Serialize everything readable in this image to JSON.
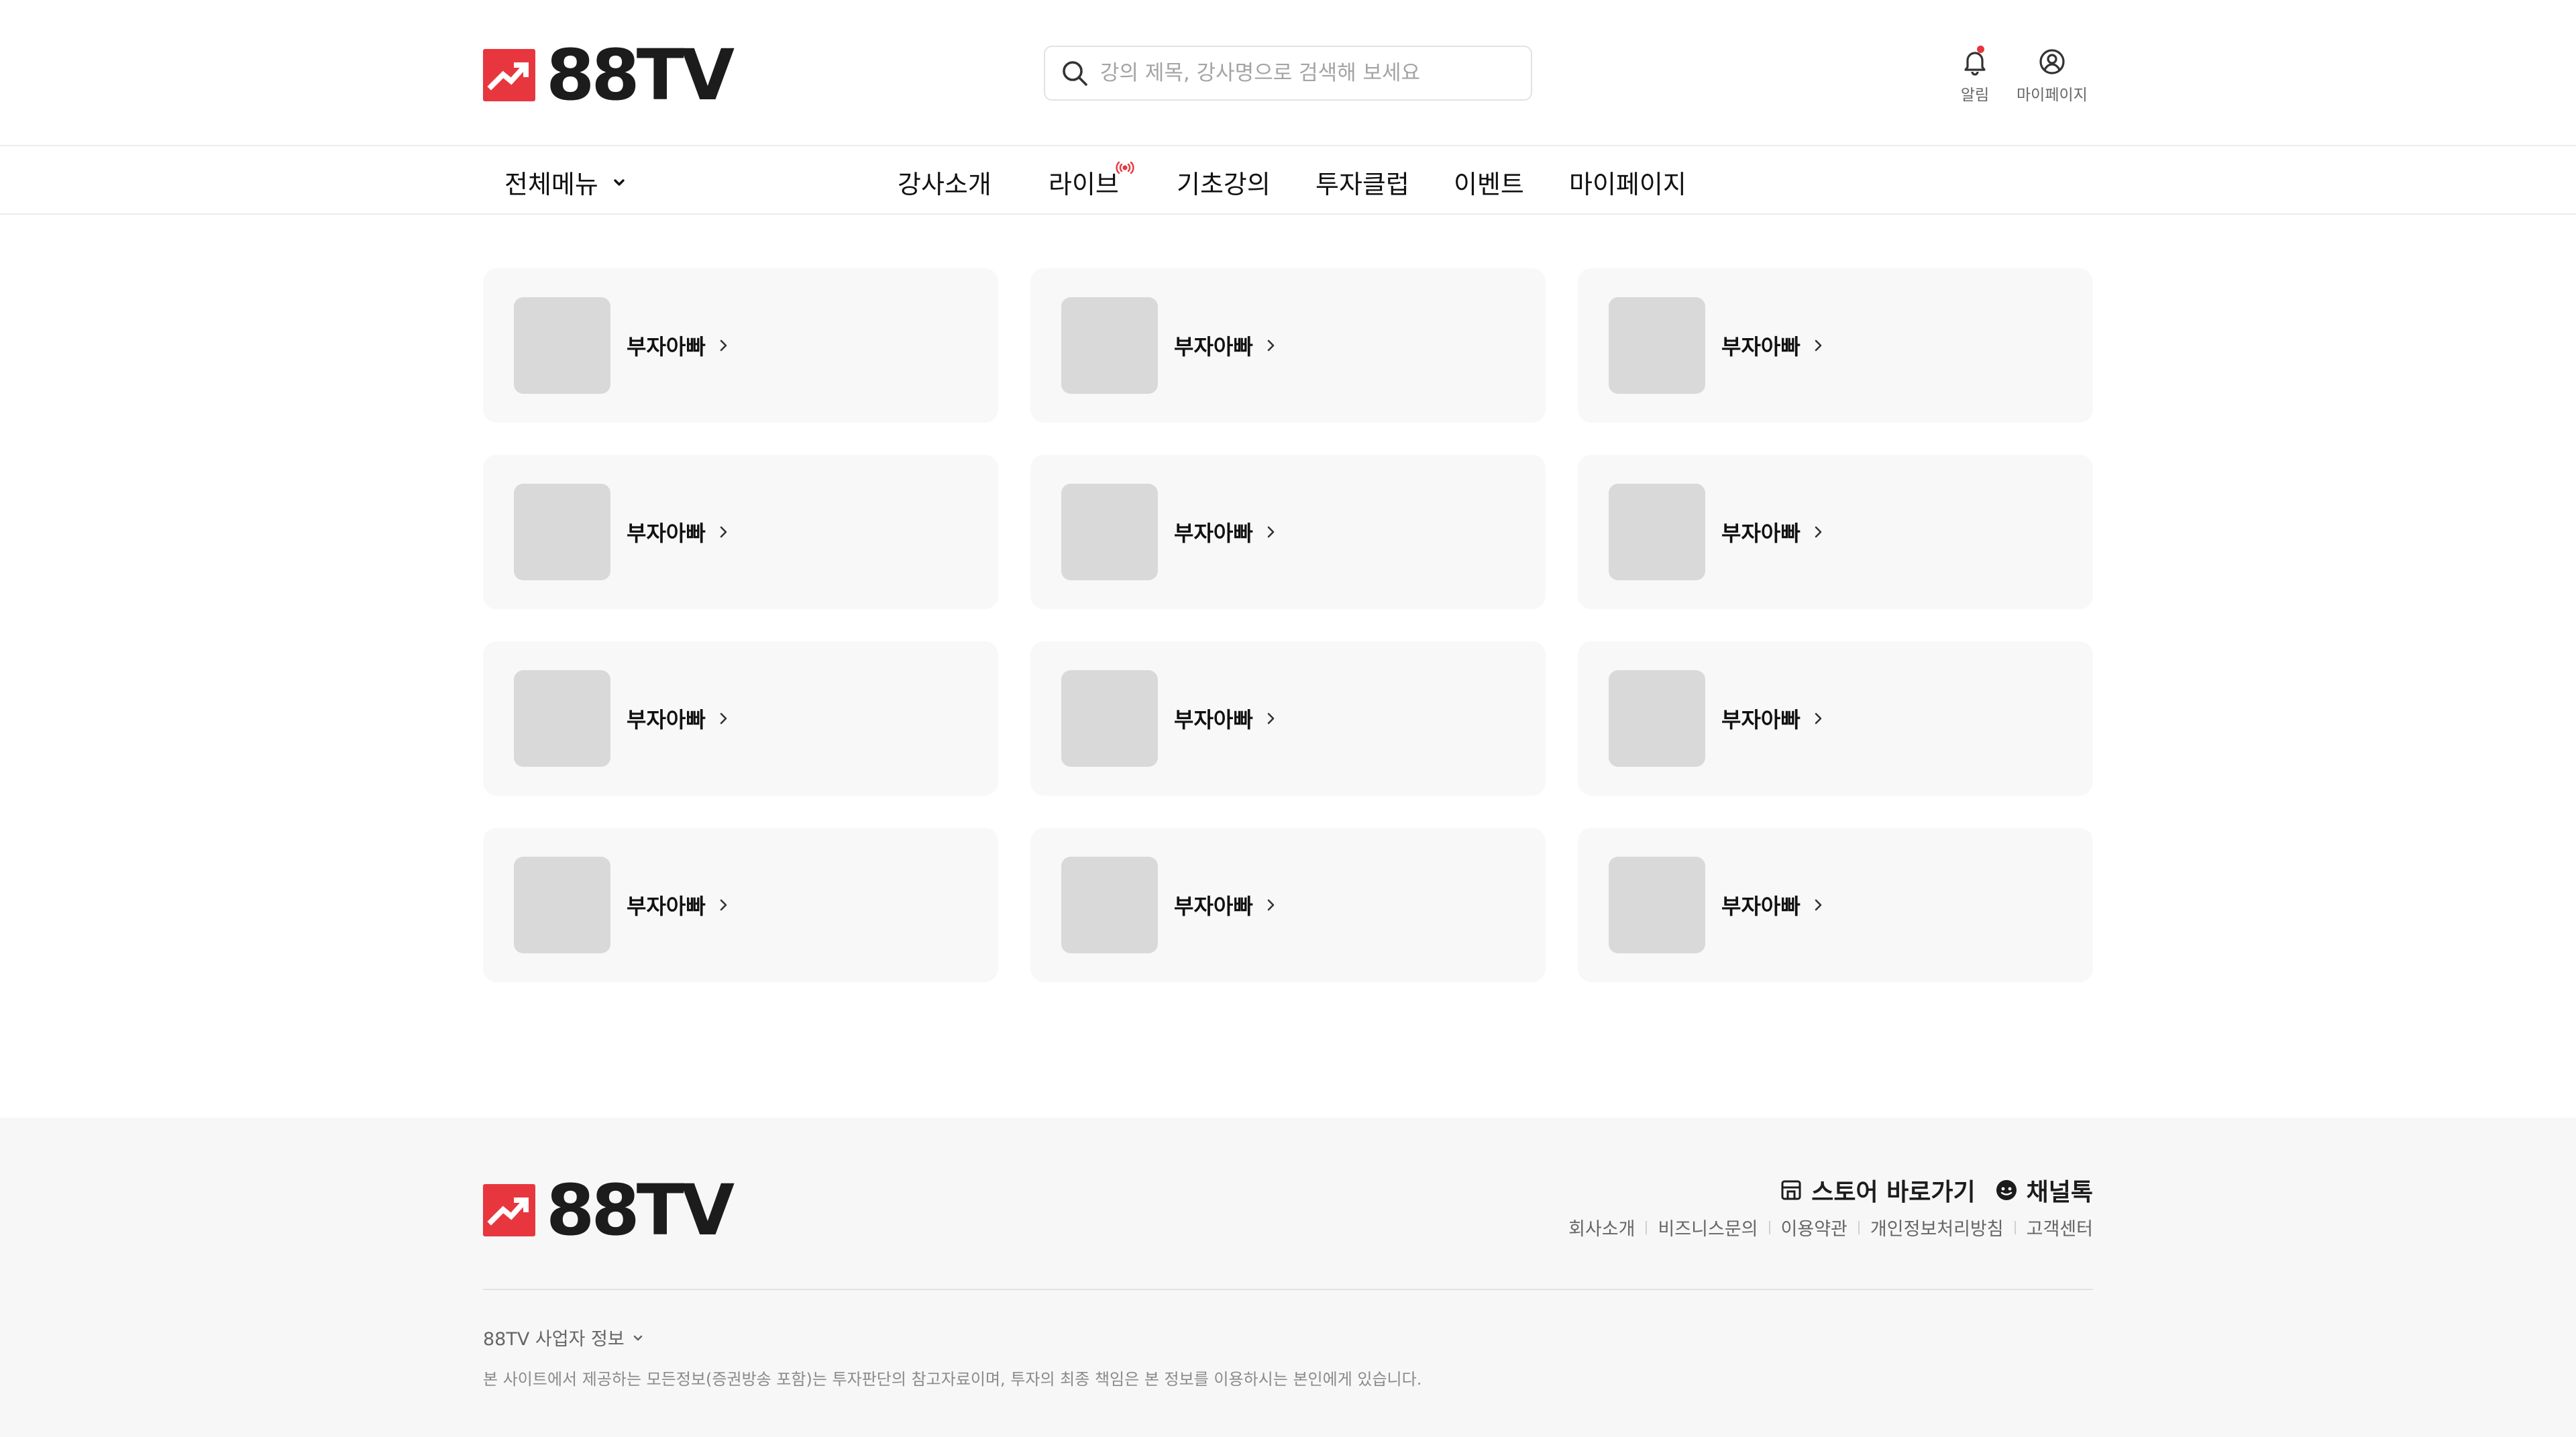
{
  "header": {
    "logo_text": "88TV",
    "search_placeholder": "강의 제목, 강사명으로 검색해 보세요",
    "alarm_label": "알림",
    "mypage_label": "마이페이지"
  },
  "nav": {
    "all_menu": "전체메뉴",
    "items": [
      "강사소개",
      "라이브",
      "기초강의",
      "투자클럽",
      "이벤트",
      "마이페이지"
    ]
  },
  "instructors": [
    {
      "name": "부자아빠"
    },
    {
      "name": "부자아빠"
    },
    {
      "name": "부자아빠"
    },
    {
      "name": "부자아빠"
    },
    {
      "name": "부자아빠"
    },
    {
      "name": "부자아빠"
    },
    {
      "name": "부자아빠"
    },
    {
      "name": "부자아빠"
    },
    {
      "name": "부자아빠"
    },
    {
      "name": "부자아빠"
    },
    {
      "name": "부자아빠"
    },
    {
      "name": "부자아빠"
    }
  ],
  "footer": {
    "logo_text": "88TV",
    "store_link": "스토어 바로가기",
    "channel_link": "채널톡",
    "links": [
      "회사소개",
      "비즈니스문의",
      "이용약관",
      "개인정보처리방침",
      "고객센터"
    ],
    "business_info": "88TV 사업자 정보",
    "disclaimer": "본 사이트에서 제공하는 모든정보(증권방송 포함)는 투자판단의 참고자료이며, 투자의 최종 책임은 본 정보를 이용하시는 본인에게 있습니다."
  },
  "colors": {
    "brand_red": "#e8363e",
    "card_bg": "#f8f8f8",
    "thumb_bg": "#d9d9d9",
    "footer_bg": "#f7f7f7"
  }
}
